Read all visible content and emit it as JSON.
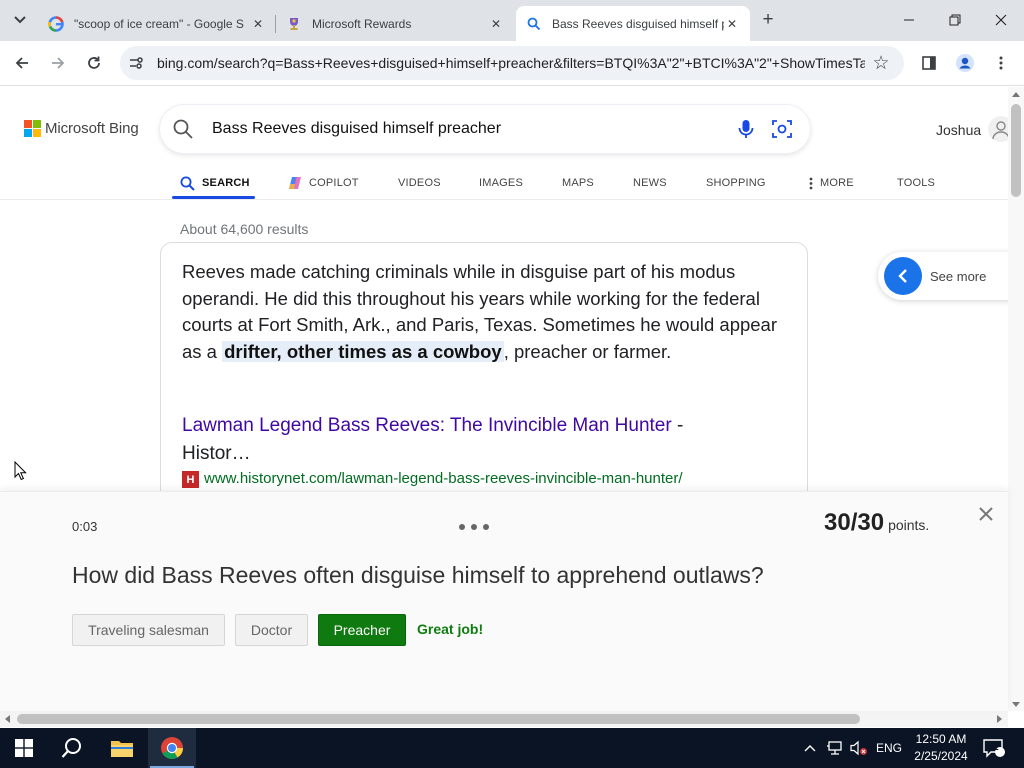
{
  "browser": {
    "tabs": [
      {
        "title": "\"scoop of ice cream\" - Google S",
        "active": false
      },
      {
        "title": "Microsoft Rewards",
        "active": false
      },
      {
        "title": "Bass Reeves disguised himself p",
        "active": true
      }
    ],
    "url": "bing.com/search?q=Bass+Reeves+disguised+himself+preacher&filters=BTQI%3A\"2\"+BTCI%3A\"2\"+ShowTimesTa..."
  },
  "bing": {
    "logo_text": "Microsoft Bing",
    "search_query": "Bass Reeves disguised himself preacher",
    "user_name": "Joshua",
    "nav": [
      "SEARCH",
      "COPILOT",
      "VIDEOS",
      "IMAGES",
      "MAPS",
      "NEWS",
      "SHOPPING",
      "MORE",
      "TOOLS"
    ],
    "result_count": "About 64,600 results",
    "answer": {
      "text_before": "Reeves made catching criminals while in disguise part of his modus operandi. He did this throughout his years while working for the federal courts at Fort Smith, Ark., and Paris, Texas. Sometimes he would appear as a ",
      "highlight": "drifter, other times as a cowboy",
      "text_after": ", preacher or farmer.",
      "source_title": "Lawman Legend Bass Reeves: The Invincible Man Hunter",
      "source_title_suffix": " - Histor…",
      "source_favicon_letter": "H",
      "source_url": "www.historynet.com/lawman-legend-bass-reeves-invincible-man-hunter/"
    },
    "see_more": "See more"
  },
  "quiz": {
    "timer": "0:03",
    "score": "30",
    "total": "30",
    "points_label": "points.",
    "question": "How did Bass Reeves often disguise himself to apprehend outlaws?",
    "options": [
      "Traveling salesman",
      "Doctor",
      "Preacher"
    ],
    "correct_option": "Preacher",
    "feedback": "Great job!"
  },
  "taskbar": {
    "language": "ENG",
    "time": "12:50 AM",
    "date": "2/25/2024",
    "notification_count": "1"
  },
  "colors": {
    "bing_accent": "#174ae4",
    "link": "#4007a2",
    "url_green": "#006d21",
    "correct_green": "#0f7a0f",
    "taskbar": "#0a1424"
  }
}
